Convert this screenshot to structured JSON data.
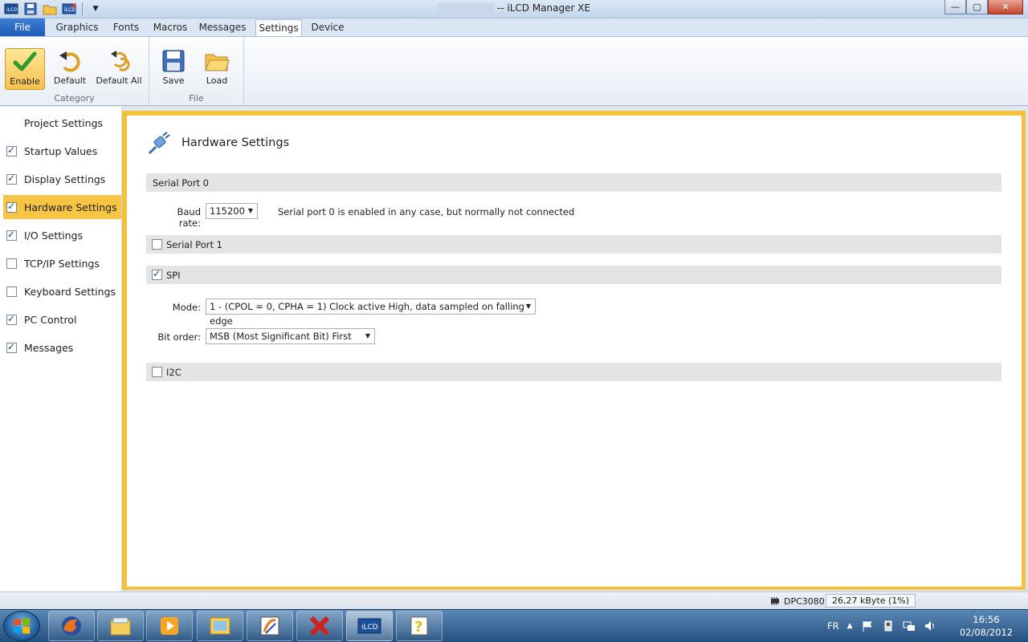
{
  "window": {
    "title": "-- iLCD Manager XE",
    "controls": {
      "minimize": "—",
      "maximize": "▢",
      "close": "✕"
    }
  },
  "quick_access": [
    "ilcd-app-icon",
    "save-icon",
    "open-folder-icon",
    "ilcd-icon",
    "dropdown-arrow-icon"
  ],
  "ribbon": {
    "file_tab": "File",
    "tabs": [
      "Graphics",
      "Fonts",
      "Macros",
      "Messages",
      "Settings",
      "Device"
    ],
    "active_tab": "Settings",
    "groups": [
      {
        "label": "Category",
        "buttons": [
          {
            "label": "Enable",
            "icon": "checkmark-icon",
            "active": true
          },
          {
            "label": "Default",
            "icon": "undo-arrow-icon"
          },
          {
            "label": "Default All",
            "icon": "undo-all-arrows-icon"
          }
        ]
      },
      {
        "label": "File",
        "buttons": [
          {
            "label": "Save",
            "icon": "floppy-disk-icon"
          },
          {
            "label": "Load",
            "icon": "folder-open-icon"
          }
        ]
      }
    ]
  },
  "sidebar": {
    "items": [
      {
        "label": "Project Settings",
        "has_checkbox": false,
        "checked": false
      },
      {
        "label": "Startup Values",
        "has_checkbox": true,
        "checked": true
      },
      {
        "label": "Display Settings",
        "has_checkbox": true,
        "checked": true
      },
      {
        "label": "Hardware Settings",
        "has_checkbox": true,
        "checked": true,
        "active": true
      },
      {
        "label": "I/O Settings",
        "has_checkbox": true,
        "checked": true
      },
      {
        "label": "TCP/IP Settings",
        "has_checkbox": true,
        "checked": false
      },
      {
        "label": "Keyboard Settings",
        "has_checkbox": true,
        "checked": false
      },
      {
        "label": "PC Control",
        "has_checkbox": true,
        "checked": true
      },
      {
        "label": "Messages",
        "has_checkbox": true,
        "checked": true
      }
    ]
  },
  "main": {
    "title": "Hardware Settings",
    "serial0": {
      "header": "Serial Port 0",
      "baud_label": "Baud rate:",
      "baud_value": "115200",
      "note": "Serial port 0 is enabled in any case, but normally not connected"
    },
    "serial1": {
      "header": "Serial Port 1",
      "checked": false
    },
    "spi": {
      "header": "SPI",
      "checked": true,
      "mode_label": "Mode:",
      "mode_value": "1 - (CPOL = 0, CPHA = 1) Clock active High, data sampled on falling edge",
      "bitorder_label": "Bit order:",
      "bitorder_value": "MSB (Most Significant Bit) First"
    },
    "i2c": {
      "header": "I2C",
      "checked": false
    }
  },
  "statusbar": {
    "device": "DPC3080",
    "size": "26,27 kByte (1%)"
  },
  "taskbar": {
    "language": "FR",
    "time": "16:56",
    "date": "02/08/2012",
    "apps": [
      "firefox-icon",
      "file-explorer-icon",
      "media-player-icon",
      "image-viewer-icon",
      "drawing-app-icon",
      "red-x-app-icon",
      "ilcd-manager-icon",
      "help-icon"
    ]
  },
  "colors": {
    "accent": "#f7c543",
    "active_frame": "#f3c13b",
    "section_band": "#e4e4e4",
    "file_tab": "#2a6cc8"
  }
}
